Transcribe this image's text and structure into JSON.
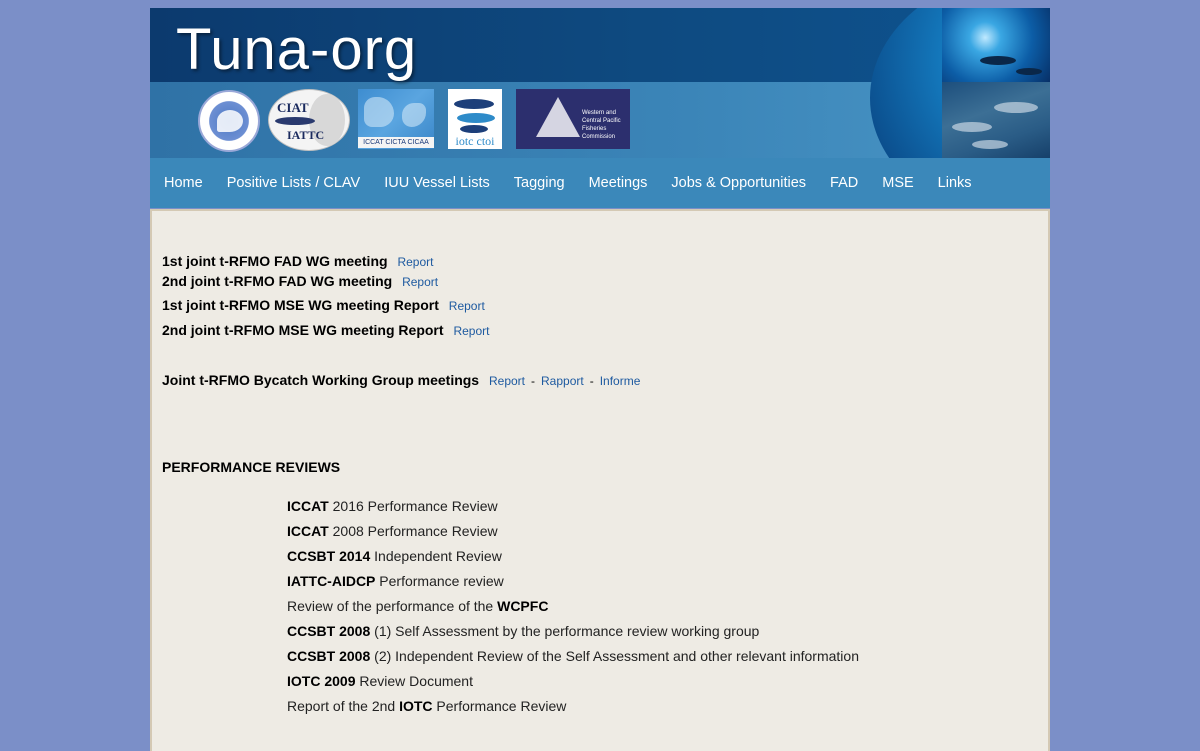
{
  "banner": {
    "title": "Tuna-org",
    "logos": {
      "iattc_line1": "CIAT",
      "iattc_line2": "IATTC",
      "iccat_caption": "ICCAT  CICTA  CICAA",
      "iotc_caption": "iotc ctoi",
      "wcpfc_caption": "Western and Central Pacific Fisheries Commission"
    }
  },
  "nav": [
    "Home",
    "Positive Lists / CLAV",
    "IUU Vessel Lists",
    "Tagging",
    "Meetings",
    "Jobs & Opportunities",
    "FAD",
    "MSE",
    "Links"
  ],
  "meetings": [
    {
      "title": "1st joint t-RFMO FAD WG meeting",
      "link": "Report"
    },
    {
      "title": "2nd joint t-RFMO FAD WG meeting",
      "link": "Report"
    },
    {
      "title": "1st joint t-RFMO MSE WG meeting Report",
      "link": "Report"
    },
    {
      "title": "2nd joint t-RFMO MSE WG meeting Report",
      "link": "Report"
    }
  ],
  "bycatch": {
    "title": "Joint t-RFMO Bycatch Working Group meetings",
    "links": [
      "Report",
      "Rapport",
      "Informe"
    ],
    "separator": "-"
  },
  "performance": {
    "heading": "PERFORMANCE REVIEWS",
    "items": [
      {
        "pre": "",
        "bold": "ICCAT",
        "post": " 2016 Performance Review"
      },
      {
        "pre": "",
        "bold": "ICCAT",
        "post": " 2008 Performance Review"
      },
      {
        "pre": "",
        "bold": "CCSBT 2014",
        "post": " Independent Review"
      },
      {
        "pre": "",
        "bold": "IATTC-AIDCP",
        "post": " Performance review"
      },
      {
        "pre": "Review of the performance of the ",
        "bold": "WCPFC",
        "post": ""
      },
      {
        "pre": "",
        "bold": "CCSBT 2008",
        "post": " (1) Self Assessment by the performance review working group"
      },
      {
        "pre": "",
        "bold": "CCSBT 2008",
        "post": " (2) Independent Review of the Self Assessment and other relevant information"
      },
      {
        "pre": "",
        "bold": "IOTC 2009",
        "post": " Review Document"
      },
      {
        "pre": "Report of the 2nd ",
        "bold": "IOTC",
        "post": " Performance Review"
      }
    ]
  },
  "colors": {
    "background": "#7b8fc8",
    "nav": "#3b88ba",
    "content": "#eeebe4",
    "link": "#1e5aa0"
  }
}
